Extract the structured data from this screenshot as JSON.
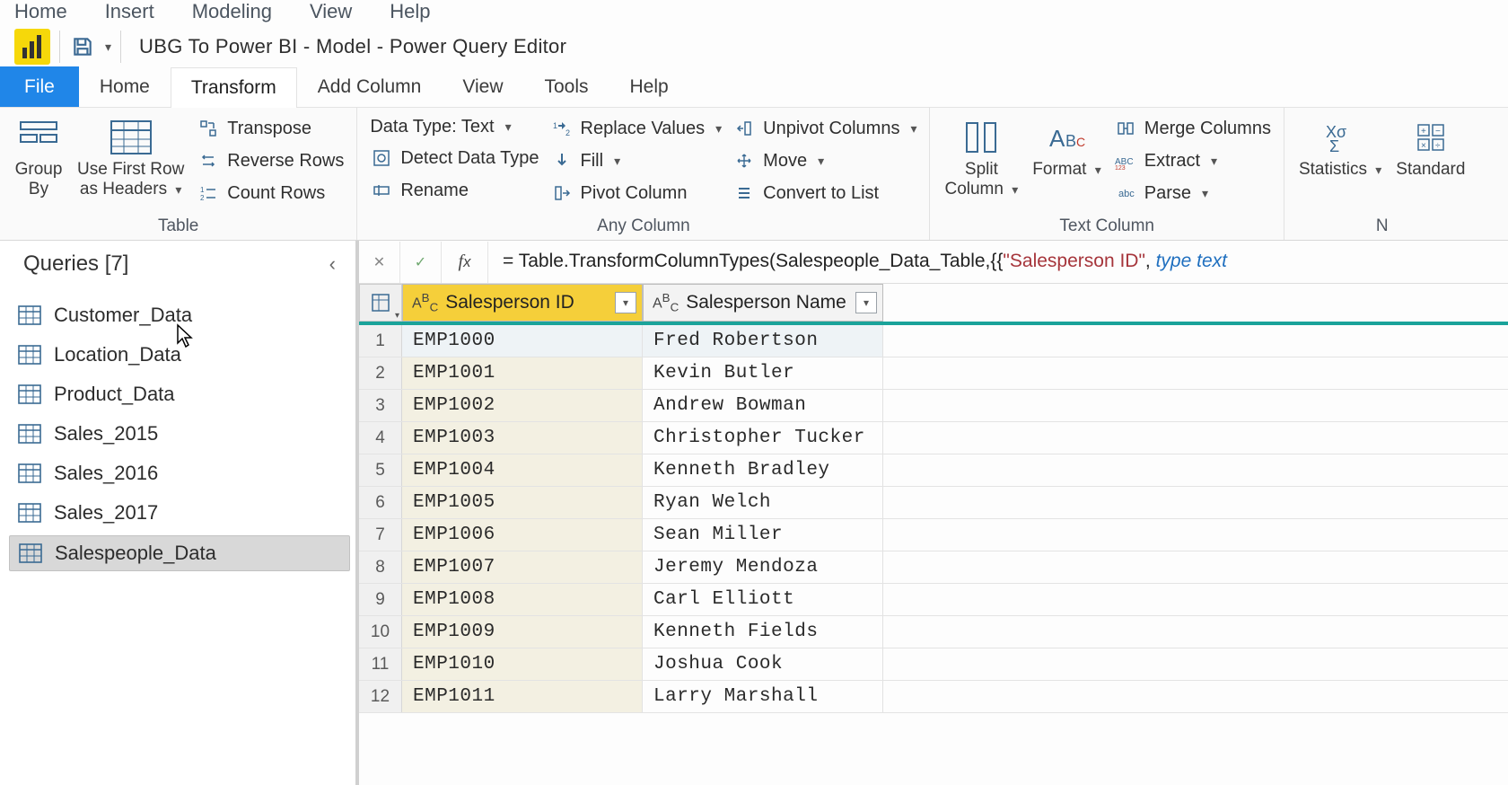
{
  "topmenu": {
    "home": "Home",
    "insert": "Insert",
    "modeling": "Modeling",
    "view": "View",
    "help": "Help"
  },
  "title": "UBG To Power BI - Model - Power Query Editor",
  "rtabs": {
    "file": "File",
    "home": "Home",
    "transform": "Transform",
    "addcol": "Add Column",
    "view": "View",
    "tools": "Tools",
    "help": "Help"
  },
  "ribbon": {
    "table": {
      "groupby": "Group\nBy",
      "firstrow": "Use First Row\nas Headers",
      "transpose": "Transpose",
      "reverse": "Reverse Rows",
      "count": "Count Rows",
      "label": "Table"
    },
    "anycol": {
      "dtype": "Data Type: Text",
      "detect": "Detect Data Type",
      "rename": "Rename",
      "replace": "Replace Values",
      "fill": "Fill",
      "pivot": "Pivot Column",
      "unpivot": "Unpivot Columns",
      "move": "Move",
      "convert": "Convert to List",
      "label": "Any Column"
    },
    "textcol": {
      "split": "Split\nColumn",
      "format": "Format",
      "merge": "Merge Columns",
      "extract": "Extract",
      "parse": "Parse",
      "label": "Text Column"
    },
    "numcol": {
      "stats": "Statistics",
      "standard": "Standard",
      "label": "N"
    }
  },
  "sidebar": {
    "head": "Queries [7]",
    "items": [
      {
        "label": "Customer_Data"
      },
      {
        "label": "Location_Data"
      },
      {
        "label": "Product_Data"
      },
      {
        "label": "Sales_2015"
      },
      {
        "label": "Sales_2016"
      },
      {
        "label": "Sales_2017"
      },
      {
        "label": "Salespeople_Data"
      }
    ]
  },
  "fx": {
    "prefix": "= Table.TransformColumnTypes(Salespeople_Data_Table,{{",
    "strpart": "\"Salesperson ID\"",
    "mid": ", ",
    "kw": "type text"
  },
  "columns": [
    {
      "type": "ABC",
      "name": "Salesperson ID"
    },
    {
      "type": "ABC",
      "name": "Salesperson Name"
    }
  ],
  "rows": [
    {
      "n": "1",
      "id": "EMP1000",
      "name": "Fred Robertson"
    },
    {
      "n": "2",
      "id": "EMP1001",
      "name": "Kevin Butler"
    },
    {
      "n": "3",
      "id": "EMP1002",
      "name": "Andrew Bowman"
    },
    {
      "n": "4",
      "id": "EMP1003",
      "name": "Christopher Tucker"
    },
    {
      "n": "5",
      "id": "EMP1004",
      "name": "Kenneth Bradley"
    },
    {
      "n": "6",
      "id": "EMP1005",
      "name": "Ryan Welch"
    },
    {
      "n": "7",
      "id": "EMP1006",
      "name": "Sean Miller"
    },
    {
      "n": "8",
      "id": "EMP1007",
      "name": "Jeremy Mendoza"
    },
    {
      "n": "9",
      "id": "EMP1008",
      "name": "Carl Elliott"
    },
    {
      "n": "10",
      "id": "EMP1009",
      "name": "Kenneth Fields"
    },
    {
      "n": "11",
      "id": "EMP1010",
      "name": "Joshua Cook"
    },
    {
      "n": "12",
      "id": "EMP1011",
      "name": "Larry Marshall"
    }
  ]
}
